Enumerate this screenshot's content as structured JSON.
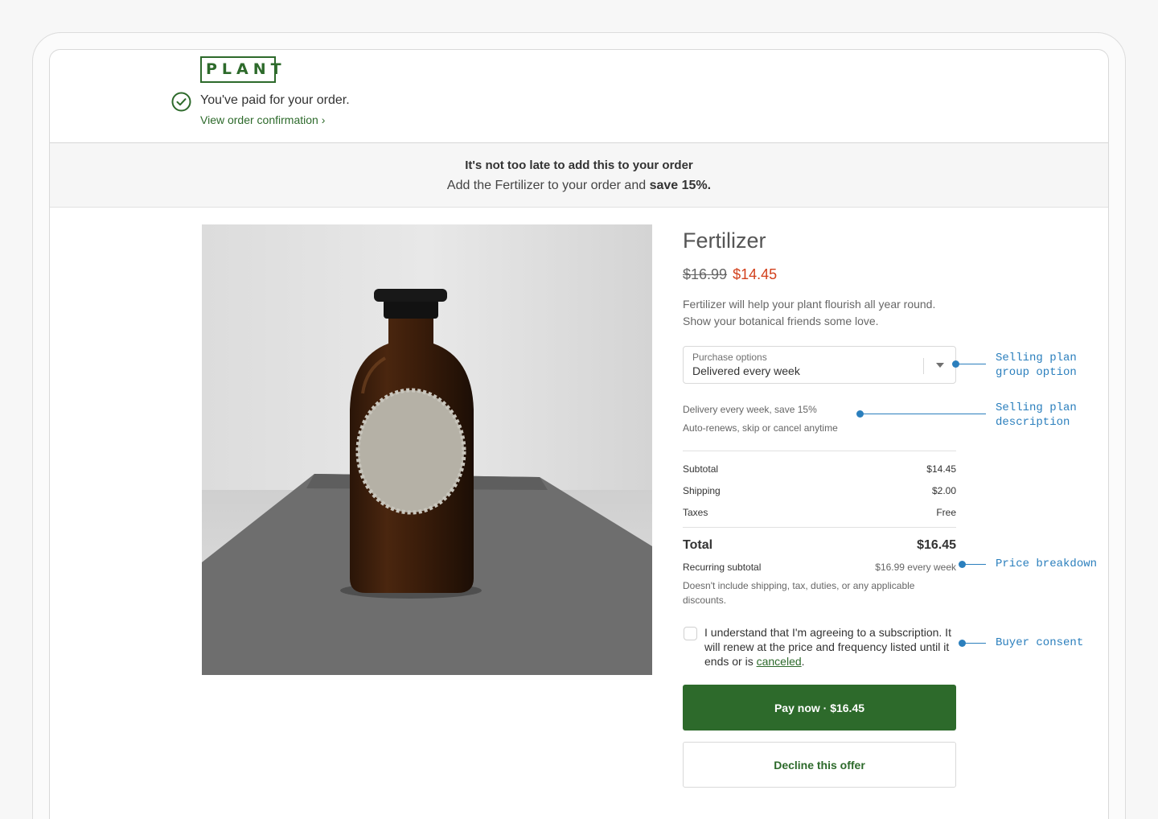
{
  "header": {
    "logo_text": "PLANT",
    "paid_message": "You've paid for your order.",
    "view_confirmation": "View order confirmation ›"
  },
  "banner": {
    "title": "It's not too late to add this to your order",
    "subtitle_prefix": "Add the Fertilizer to your order and ",
    "subtitle_bold": "save 15%."
  },
  "product": {
    "title": "Fertilizer",
    "original_price": "$16.99",
    "sale_price": "$14.45",
    "description_line1": "Fertilizer will help your plant flourish all year round.",
    "description_line2": "Show your botanical friends some love."
  },
  "purchase_options": {
    "label": "Purchase options",
    "value": "Delivered every week"
  },
  "plan_description": {
    "line1": "Delivery every week, save 15%",
    "line2": "Auto-renews, skip or cancel anytime"
  },
  "breakdown": {
    "rows": [
      {
        "label": "Subtotal",
        "value": "$14.45"
      },
      {
        "label": "Shipping",
        "value": "$2.00"
      },
      {
        "label": "Taxes",
        "value": "Free"
      }
    ],
    "total_label": "Total",
    "total_value": "$16.45",
    "recurring_label": "Recurring subtotal",
    "recurring_value": "$16.99 every week",
    "recurring_note": "Doesn't include shipping, tax, duties, or any applicable discounts."
  },
  "consent": {
    "text": "I understand that I'm agreeing to a subscription. It will renew at the price and frequency listed until it ends or is ",
    "link": "canceled",
    "suffix": "."
  },
  "actions": {
    "pay": "Pay now · $16.45",
    "decline": "Decline this offer"
  },
  "annotations": {
    "group_option_l1": "Selling plan",
    "group_option_l2": "group option",
    "description_l1": "Selling plan",
    "description_l2": "description",
    "price_breakdown": "Price breakdown",
    "buyer_consent": "Buyer consent"
  },
  "colors": {
    "brand_green": "#2d6a2b",
    "sale_red": "#d2401c",
    "annotation_blue": "#2b7fbd"
  }
}
